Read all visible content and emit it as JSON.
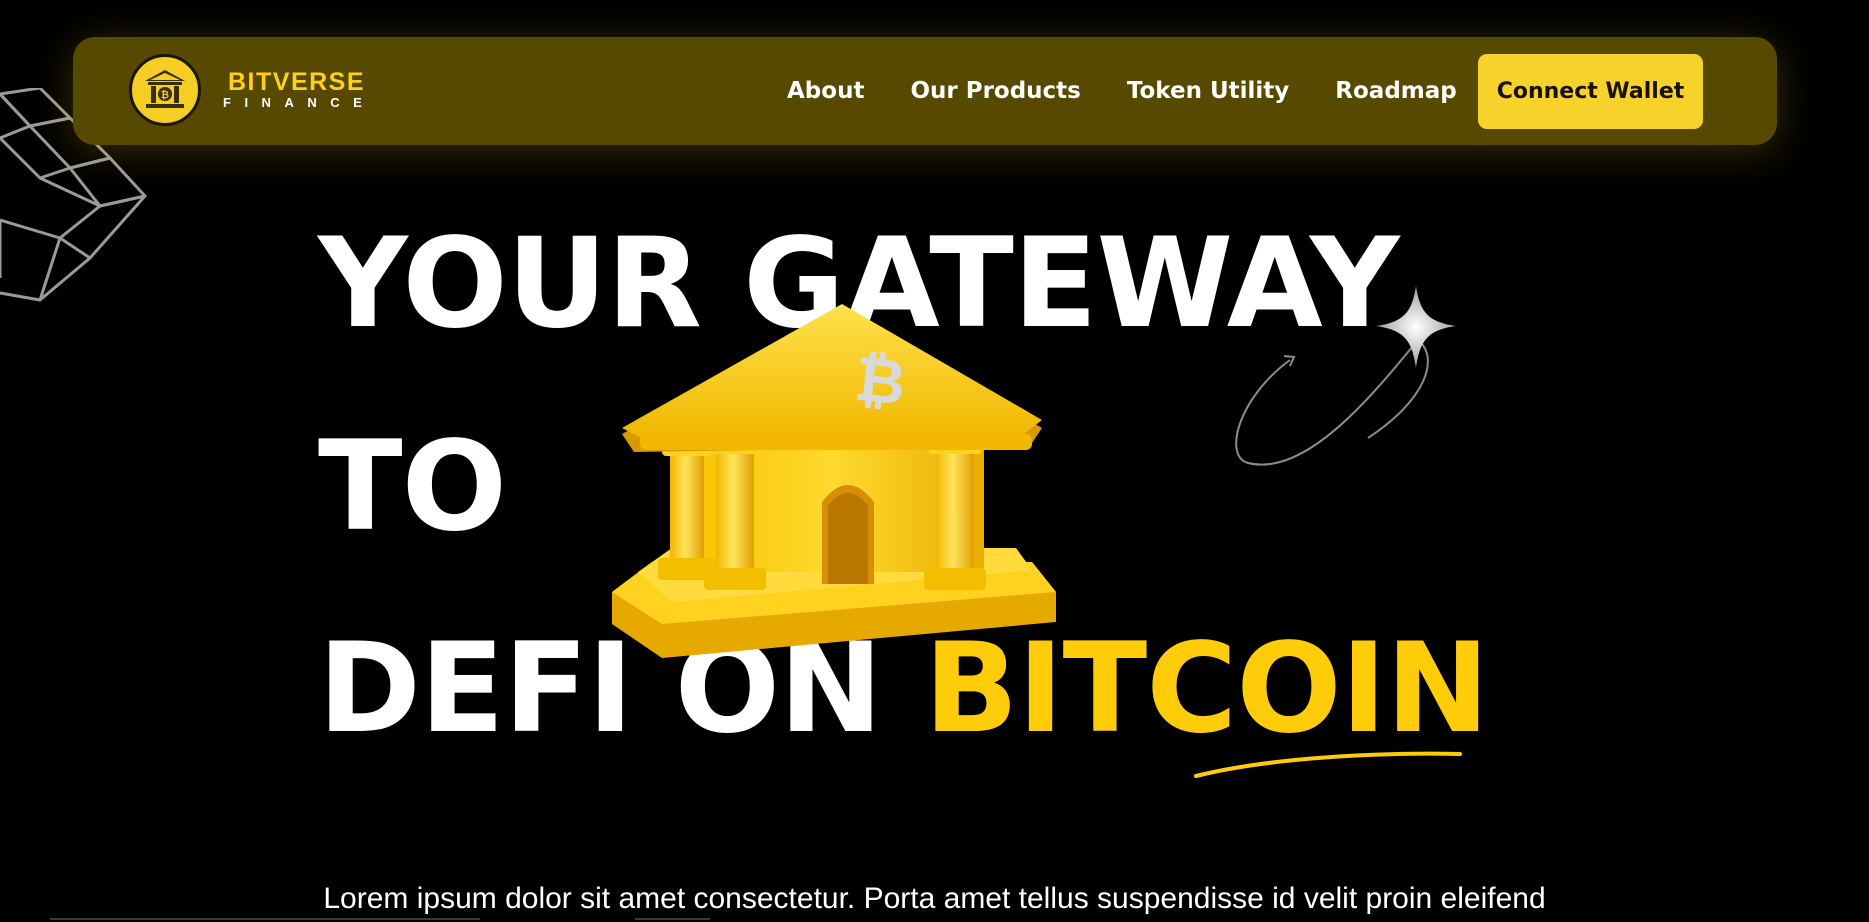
{
  "brand": {
    "name": "BITVERSE",
    "sub": "FINANCE",
    "logo_icon": "bank-bitcoin-icon"
  },
  "nav": {
    "links": [
      "About",
      "Our Products",
      "Token Utility",
      "Roadmap"
    ],
    "cta_label": "Connect Wallet"
  },
  "hero": {
    "line1": "YOUR GATEWAY",
    "line2": "TO",
    "line3_start": "DEFI ON ",
    "line3_highlight": "BITCOIN",
    "image_icon": "bitcoin-bank-icon",
    "subtitle": "Lorem ipsum dolor sit amet consectetur. Porta amet tellus suspendisse id velit proin eleifend"
  },
  "colors": {
    "background": "#000000",
    "navbar": "#574a00",
    "accent": "#ffcc0a",
    "button": "#f7d22a"
  }
}
